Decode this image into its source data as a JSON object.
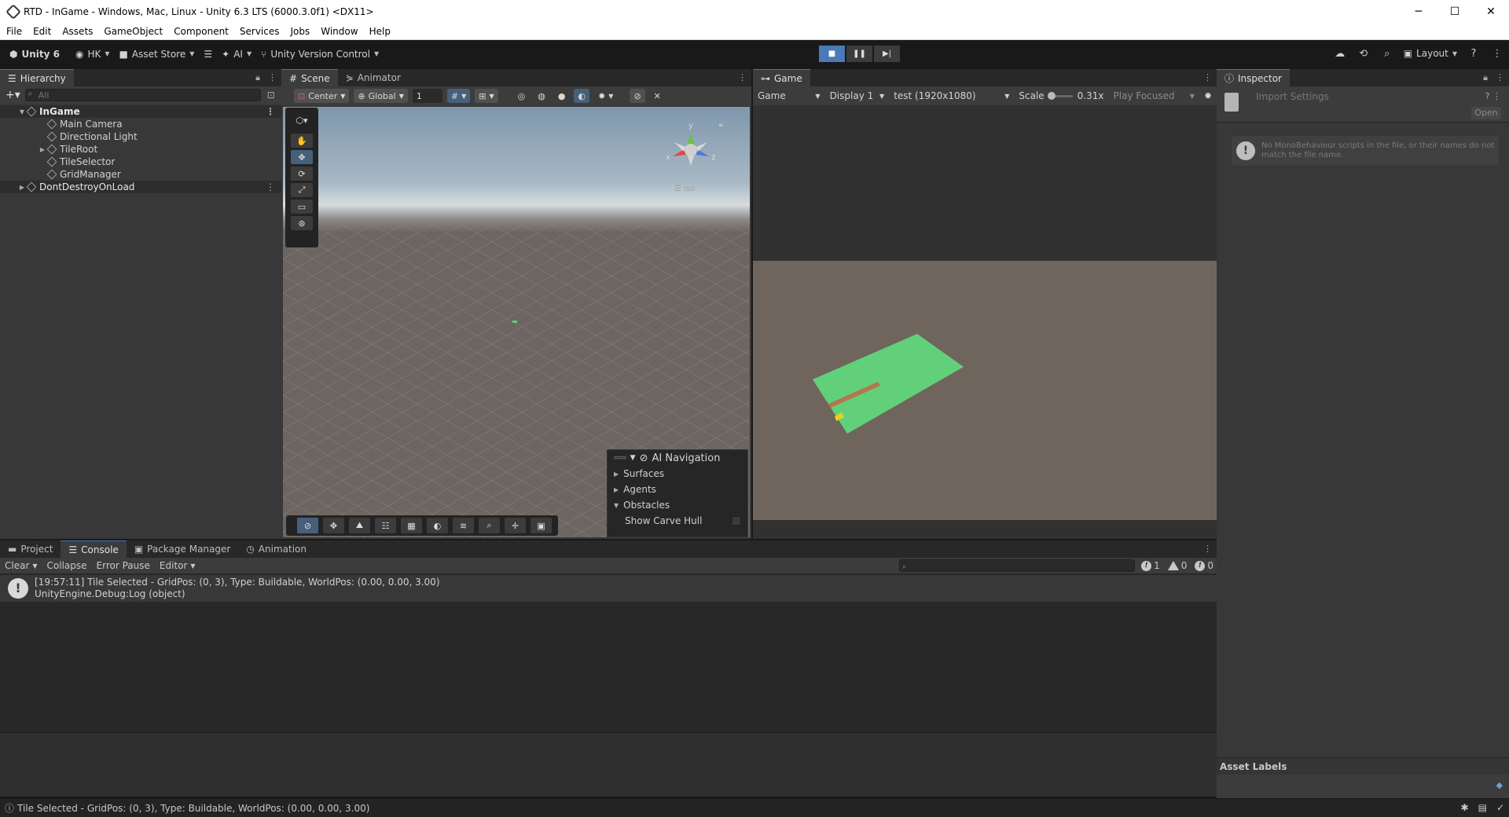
{
  "window": {
    "title": "RTD - InGame - Windows, Mac, Linux - Unity 6.3 LTS (6000.3.0f1) <DX11>",
    "minimize": "─",
    "maximize": "☐",
    "close": "✕"
  },
  "menu": [
    "File",
    "Edit",
    "Assets",
    "GameObject",
    "Component",
    "Services",
    "Jobs",
    "Window",
    "Help"
  ],
  "toolbar": {
    "unity_label": "Unity 6",
    "account": "HK",
    "asset_store": "Asset Store",
    "ai": "AI",
    "version_control": "Unity Version Control",
    "layout": "Layout"
  },
  "hierarchy": {
    "tab": "Hierarchy",
    "search_placeholder": "All",
    "items": [
      {
        "label": "InGame",
        "depth": 0,
        "scene": true,
        "expanded": true
      },
      {
        "label": "Main Camera",
        "depth": 1
      },
      {
        "label": "Directional Light",
        "depth": 1
      },
      {
        "label": "TileRoot",
        "depth": 1,
        "collapsed": true
      },
      {
        "label": "TileSelector",
        "depth": 1
      },
      {
        "label": "GridManager",
        "depth": 1
      },
      {
        "label": "DontDestroyOnLoad",
        "depth": 0,
        "scene": true,
        "collapsed": true
      }
    ]
  },
  "scene": {
    "tabs": [
      "Scene",
      "Animator"
    ],
    "pivot": "Center",
    "space": "Global",
    "grid_size": "1",
    "gizmo_axes": {
      "y": "y",
      "x": "x",
      "z": "z"
    },
    "persp_label": "Iso",
    "ai_navigation": {
      "title": "AI Navigation",
      "rows": [
        "Surfaces",
        "Agents",
        "Obstacles"
      ],
      "toggle_label": "Show Carve Hull"
    }
  },
  "game": {
    "tab": "Game",
    "mode": "Game",
    "display": "Display 1",
    "resolution": "test (1920x1080)",
    "scale_label": "Scale",
    "scale_value": "0.31x",
    "play_mode": "Play Focused"
  },
  "inspector": {
    "tab": "Inspector",
    "subtitle": "Import Settings",
    "open_button": "Open",
    "message": "No MonoBehaviour scripts in the file, or their names do not match the file name.",
    "asset_labels": "Asset Labels"
  },
  "bottom_tabs": [
    "Project",
    "Console",
    "Package Manager",
    "Animation"
  ],
  "console": {
    "clear": "Clear",
    "collapse": "Collapse",
    "error_pause": "Error Pause",
    "editor": "Editor",
    "count_info": "1",
    "count_warn": "0",
    "count_error": "0",
    "log_line1": "[19:57:11] Tile Selected - GridPos: (0, 3), Type: Buildable, WorldPos: (0.00, 0.00, 3.00)",
    "log_line2": "UnityEngine.Debug:Log (object)"
  },
  "statusbar": {
    "message": "Tile Selected - GridPos: (0, 3), Type: Buildable, WorldPos: (0.00, 0.00, 3.00)"
  },
  "colors": {
    "accent": "#3a79bb",
    "play_active": "#4a7ab8",
    "tile_green": "#62d07a",
    "path_brown": "#b0784e",
    "selector_yellow": "#e6d21e"
  }
}
